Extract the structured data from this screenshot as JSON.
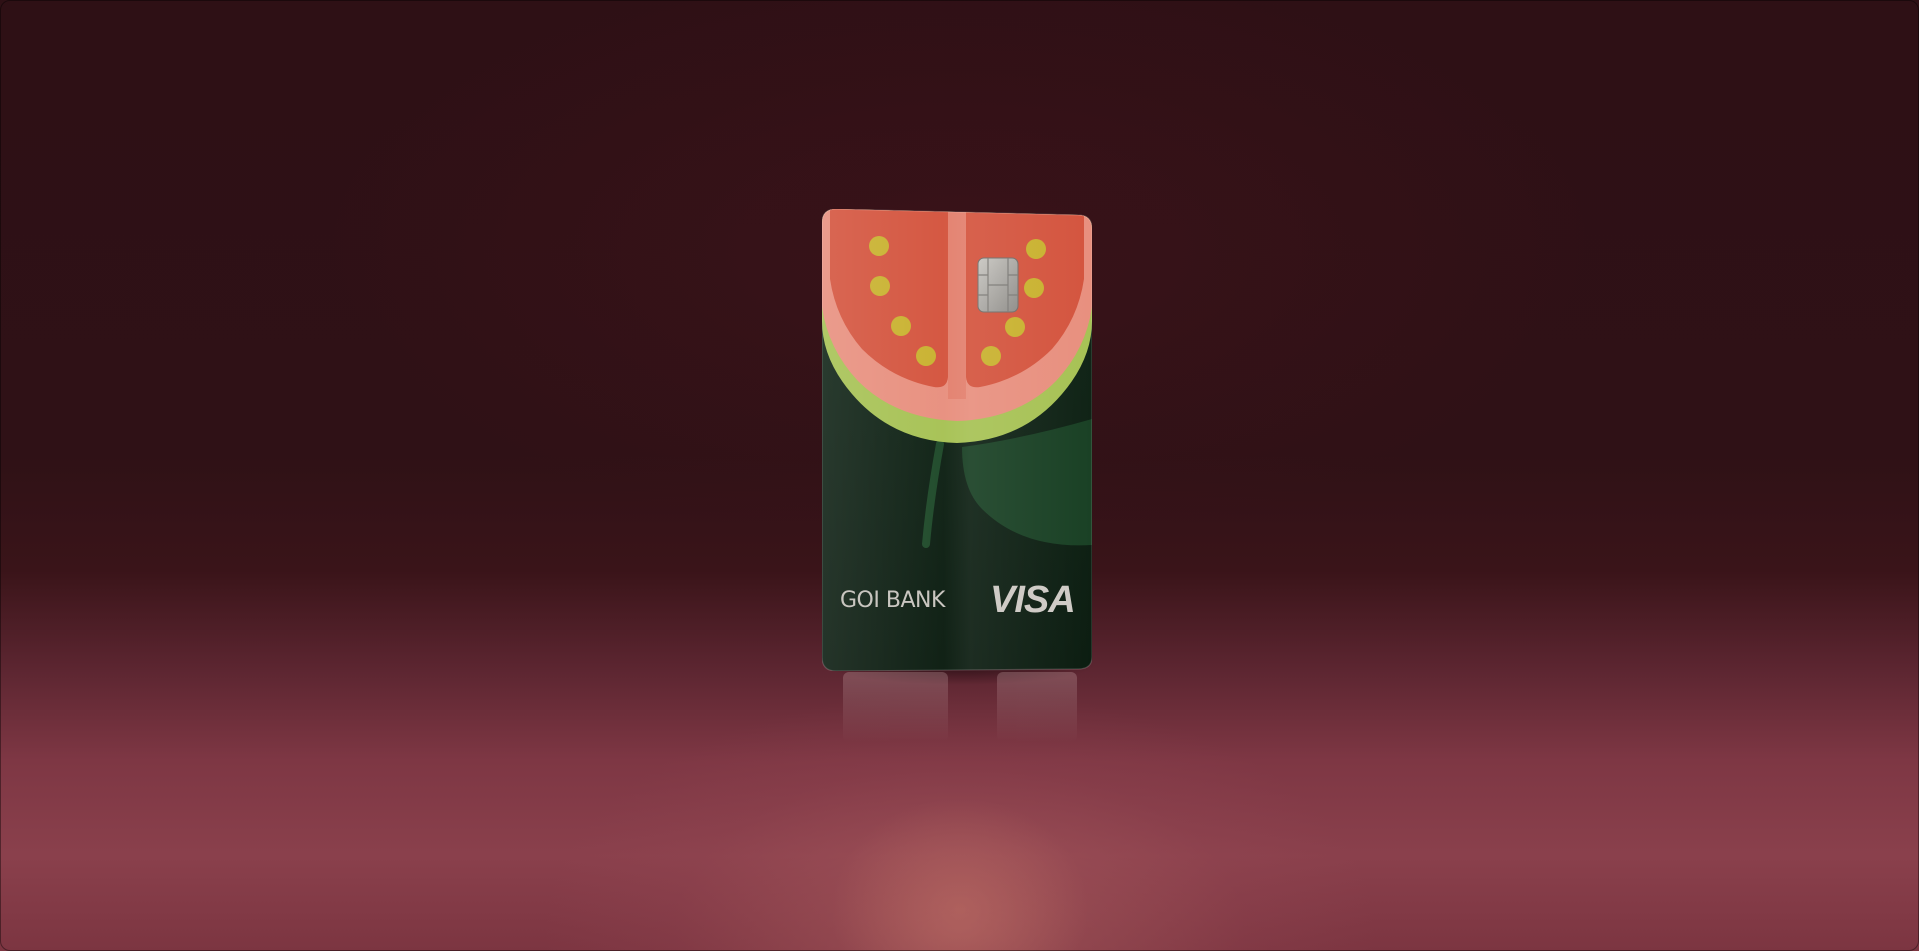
{
  "scene": {
    "description_label": "",
    "background_wall": "#2e1015",
    "floor_color": "#8a404c"
  },
  "card": {
    "bank_name": "GOI BANK",
    "network": "VISA",
    "colors": {
      "body": "#0f2214",
      "fruit_flesh": "#d4553f",
      "fruit_rind": "#e8907f",
      "fruit_skin": "#a7c255",
      "seeds": "#c9b230",
      "leaf": "#1c4326",
      "chip": "#a9a7a3"
    },
    "icons": [
      "guava-slice-artwork",
      "emv-chip-icon",
      "leaf-icon"
    ]
  }
}
